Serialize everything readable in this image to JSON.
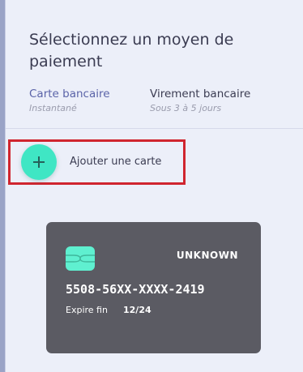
{
  "page": {
    "title": "Sélectionnez un moyen de paiement"
  },
  "tabs": [
    {
      "label": "Carte bancaire",
      "sub": "Instantané",
      "active": true
    },
    {
      "label": "Virement bancaire",
      "sub": "Sous 3 à 5 jours",
      "active": false
    }
  ],
  "add_card": {
    "label": "Ajouter une carte",
    "icon": "plus-icon"
  },
  "card": {
    "brand": "UNKNOWN",
    "number": "5508-56XX-XXXX-2419",
    "expiry_label": "Expire fin",
    "expiry_value": "12/24",
    "chip_icon": "card-chip-icon"
  },
  "colors": {
    "accent": "#5a63a8",
    "add_button": "#3fe6c4",
    "highlight_border": "#d0252f",
    "card_bg": "#5b5b63",
    "chip": "#5ff0d0"
  }
}
